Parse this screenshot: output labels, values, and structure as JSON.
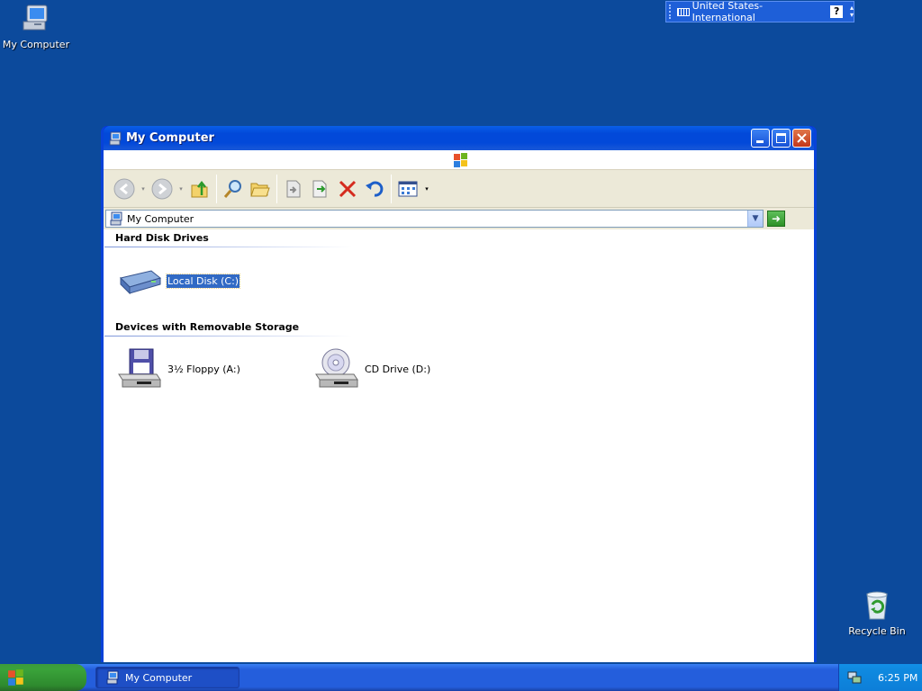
{
  "desktop": {
    "icons": [
      {
        "label": "My Computer",
        "icon": "my-computer-icon"
      },
      {
        "label": "Recycle Bin",
        "icon": "recycle-bin-icon"
      }
    ]
  },
  "language_bar": {
    "language": "United States-International",
    "help_glyph": "?"
  },
  "window": {
    "title": "My Computer",
    "address": "My Computer",
    "groups": [
      {
        "heading": "Hard Disk Drives",
        "items": [
          {
            "label": "Local Disk (C:)",
            "icon": "hard-disk-icon",
            "selected": true
          }
        ]
      },
      {
        "heading": "Devices with Removable Storage",
        "items": [
          {
            "label": "3½ Floppy (A:)",
            "icon": "floppy-drive-icon",
            "selected": false
          },
          {
            "label": "CD Drive (D:)",
            "icon": "cd-drive-icon",
            "selected": false
          }
        ]
      }
    ]
  },
  "taskbar": {
    "start_label": "",
    "tasks": [
      {
        "label": "My Computer"
      }
    ],
    "clock": "6:25 PM"
  },
  "colors": {
    "desktop": "#0c4a9c",
    "title_bar": "#0249d9",
    "selection": "#316ac5",
    "start_button": "#3aa33a",
    "taskbar": "#245edc"
  }
}
